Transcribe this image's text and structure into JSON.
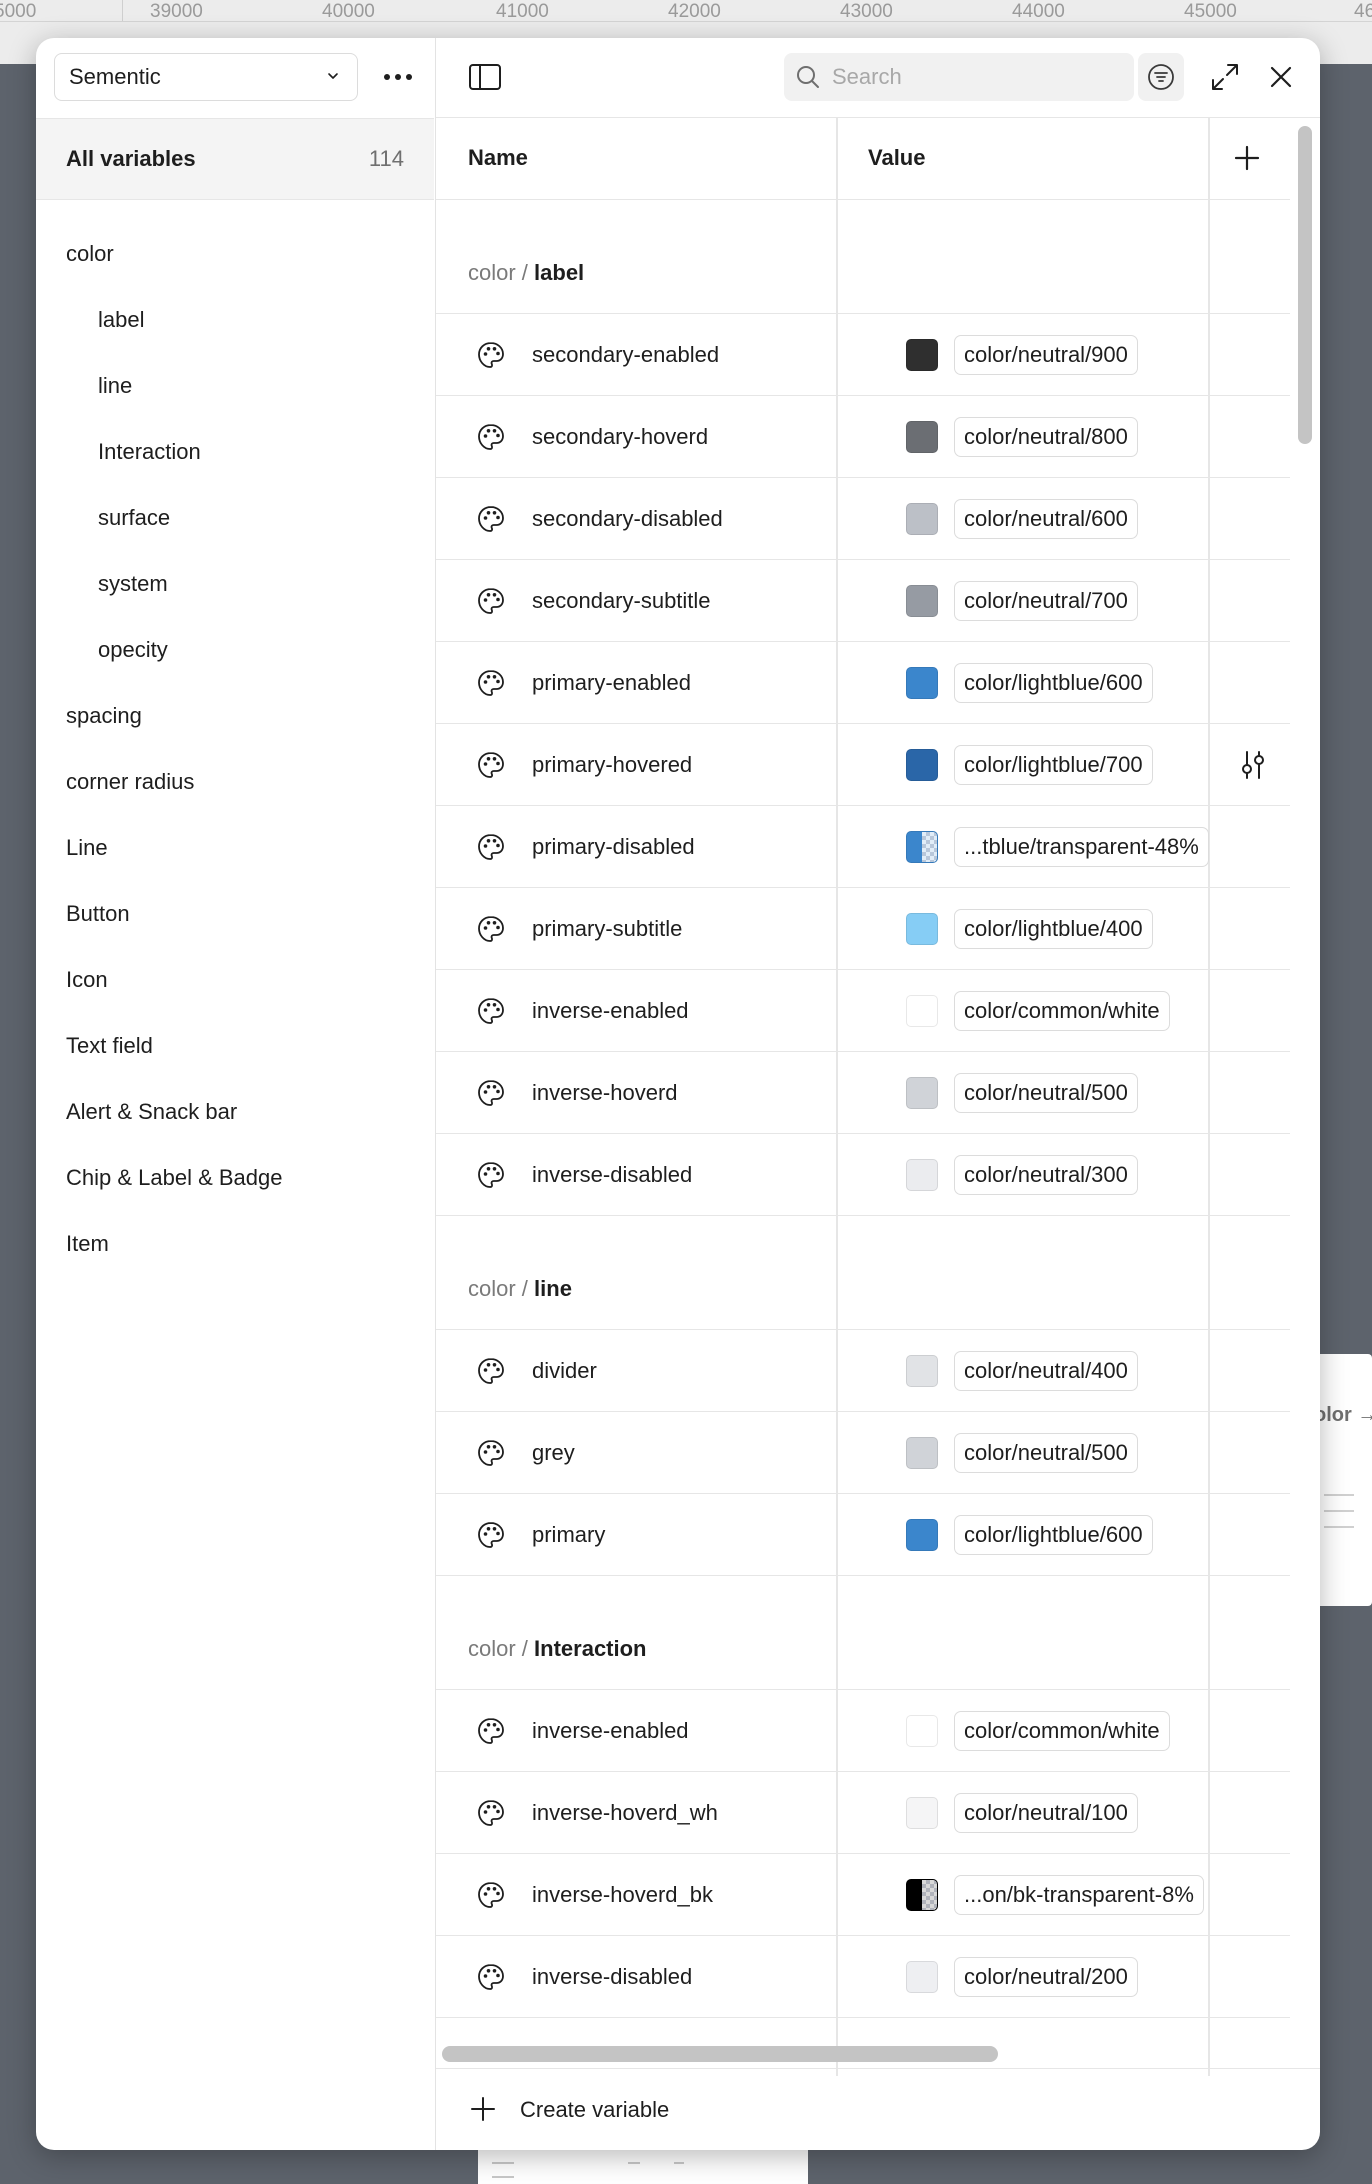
{
  "ruler": {
    "ticks": [
      "5000",
      "39000",
      "40000",
      "41000",
      "42000",
      "43000",
      "44000",
      "45000",
      "46"
    ]
  },
  "background": {
    "right_frame_fragment": "olor →"
  },
  "sidebar": {
    "collection_name": "Sementic",
    "all_variables_label": "All variables",
    "all_variables_count": "114",
    "groups": [
      {
        "label": "color",
        "sub": false
      },
      {
        "label": "label",
        "sub": true
      },
      {
        "label": "line",
        "sub": true
      },
      {
        "label": "Interaction",
        "sub": true
      },
      {
        "label": "surface",
        "sub": true
      },
      {
        "label": "system",
        "sub": true
      },
      {
        "label": "opecity",
        "sub": true
      },
      {
        "label": "spacing",
        "sub": false
      },
      {
        "label": "corner radius",
        "sub": false
      },
      {
        "label": "Line",
        "sub": false
      },
      {
        "label": "Button",
        "sub": false
      },
      {
        "label": "Icon",
        "sub": false
      },
      {
        "label": "Text field",
        "sub": false
      },
      {
        "label": "Alert & Snack bar",
        "sub": false
      },
      {
        "label": "Chip & Label & Badge",
        "sub": false
      },
      {
        "label": "Item",
        "sub": false
      }
    ]
  },
  "toolbar": {
    "search_placeholder": "Search"
  },
  "table": {
    "col_name": "Name",
    "col_value": "Value",
    "sections": [
      {
        "prefix": "color / ",
        "group": "label",
        "rows": [
          {
            "name": "secondary-enabled",
            "value": "color/neutral/900",
            "swatch": "#2f2f2f",
            "transparent": false
          },
          {
            "name": "secondary-hoverd",
            "value": "color/neutral/800",
            "swatch": "#6b6e73",
            "transparent": false
          },
          {
            "name": "secondary-disabled",
            "value": "color/neutral/600",
            "swatch": "#bcc0c7",
            "transparent": false
          },
          {
            "name": "secondary-subtitle",
            "value": "color/neutral/700",
            "swatch": "#969ba3",
            "transparent": false
          },
          {
            "name": "primary-enabled",
            "value": "color/lightblue/600",
            "swatch": "#3b86cc",
            "transparent": false
          },
          {
            "name": "primary-hovered",
            "value": "color/lightblue/700",
            "swatch": "#2a66a8",
            "transparent": false,
            "hover_edit": true
          },
          {
            "name": "primary-disabled",
            "value": "...tblue/transparent-48%",
            "swatch": "#3b86cc",
            "transparent": true
          },
          {
            "name": "primary-subtitle",
            "value": "color/lightblue/400",
            "swatch": "#86cdf5",
            "transparent": false
          },
          {
            "name": "inverse-enabled",
            "value": "color/common/white",
            "swatch": "#ffffff",
            "transparent": false
          },
          {
            "name": "inverse-hoverd",
            "value": "color/neutral/500",
            "swatch": "#d0d3d8",
            "transparent": false
          },
          {
            "name": "inverse-disabled",
            "value": "color/neutral/300",
            "swatch": "#ebecef",
            "transparent": false
          }
        ]
      },
      {
        "prefix": "color / ",
        "group": "line",
        "rows": [
          {
            "name": "divider",
            "value": "color/neutral/400",
            "swatch": "#e1e3e6",
            "transparent": false
          },
          {
            "name": "grey",
            "value": "color/neutral/500",
            "swatch": "#d0d3d8",
            "transparent": false
          },
          {
            "name": "primary",
            "value": "color/lightblue/600",
            "swatch": "#3b86cc",
            "transparent": false
          }
        ]
      },
      {
        "prefix": "color / ",
        "group": "Interaction",
        "rows": [
          {
            "name": "inverse-enabled",
            "value": "color/common/white",
            "swatch": "#ffffff",
            "transparent": false
          },
          {
            "name": "inverse-hoverd_wh",
            "value": "color/neutral/100",
            "swatch": "#f5f5f6",
            "transparent": false
          },
          {
            "name": "inverse-hoverd_bk",
            "value": "...on/bk-transparent-8%",
            "swatch": "#000000",
            "transparent": true
          },
          {
            "name": "inverse-disabled",
            "value": "color/neutral/200",
            "swatch": "#eeeff2",
            "transparent": false
          }
        ]
      }
    ]
  },
  "footer": {
    "create_label": "Create variable"
  },
  "icons": {
    "row_icon": "palette-icon",
    "edit_icon": "sliders-icon"
  }
}
